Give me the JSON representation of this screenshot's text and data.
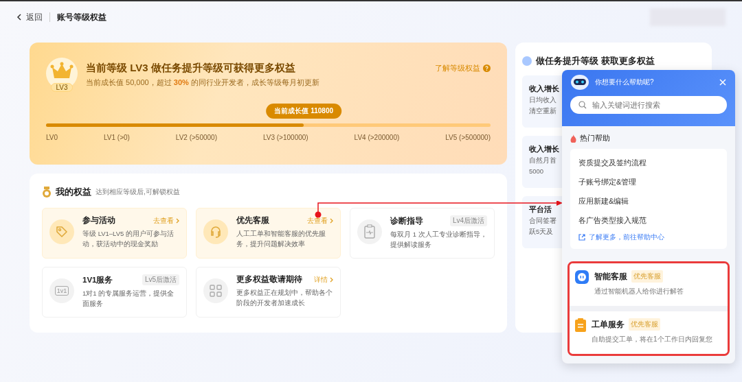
{
  "header": {
    "back": "返回",
    "title": "账号等级权益"
  },
  "level_card": {
    "badge": "LV3",
    "title": "当前等级 LV3 做任务提升等级可获得更多权益",
    "subtitle": "当前成长值 50,000，超过 **30%** 的同行业开发者，成长等级每月初更新",
    "help_link": "了解等级权益",
    "tooltip": "当前成长值 110800",
    "level": 0.58,
    "ticks": [
      "LV0",
      "LV1 (>0)",
      "LV2 (>50000)",
      "LV3 (>100000)",
      "LV4 (>200000)",
      "LV5 (>500000)"
    ]
  },
  "benefits": {
    "title": "我的权益",
    "hint": "达到相应等级后,可解锁权益",
    "items": [
      {
        "kind": "tag",
        "title": "参与活动",
        "desc": "等级 LV1–LV5 的用户可参与活动，获活动中的现金奖励",
        "action": "去查看",
        "unlocked": true
      },
      {
        "kind": "headset",
        "title": "优先客服",
        "desc": "人工工单和智能客服的优先服务，提升问题解决效率",
        "action": "去查看",
        "unlocked": true
      },
      {
        "kind": "clipboard",
        "title": "诊断指导",
        "desc": "每双月 1 次人工专业诊断指导，提供解读服务",
        "badge": "Lv4后激活",
        "unlocked": false
      },
      {
        "kind": "one",
        "icon_text": "1v1",
        "title": "1V1服务",
        "desc": "1对1 的专属服务运营，提供全面服务",
        "badge": "Lv5后激活",
        "unlocked": false
      },
      {
        "kind": "grid",
        "title": "更多权益敬请期待",
        "desc": "更多权益正在规划中，帮助各个阶段的开发者加速成长",
        "action": "详情",
        "unlocked": false
      }
    ]
  },
  "tasks": {
    "title": "做任务提升等级 获取更多权益",
    "items": [
      {
        "title": "收入增长",
        "lines": [
          "日均收入",
          "清空重新"
        ]
      },
      {
        "title": "收入增长",
        "lines": [
          "自然月首",
          "5000"
        ]
      },
      {
        "title": "平台活",
        "lines": [
          "合同签署",
          "跃5天及"
        ]
      }
    ]
  },
  "help_popup": {
    "question": "你想要什么帮助呢?",
    "search_placeholder": "输入关键词进行搜索",
    "hot_title": "热门帮助",
    "hot_items": [
      "资质提交及签约流程",
      "子账号绑定&管理",
      "应用新建&编辑",
      "各广告类型接入规范"
    ],
    "more_link": "了解更多，前往帮助中心",
    "services": [
      {
        "kind": "bot",
        "title": "智能客服",
        "tag": "优先客服",
        "desc": "通过智能机器人给你进行解答"
      },
      {
        "kind": "ticket",
        "title": "工单服务",
        "tag": "优先客服",
        "desc": "自助提交工单，将在1个工作日内回复您"
      }
    ]
  }
}
